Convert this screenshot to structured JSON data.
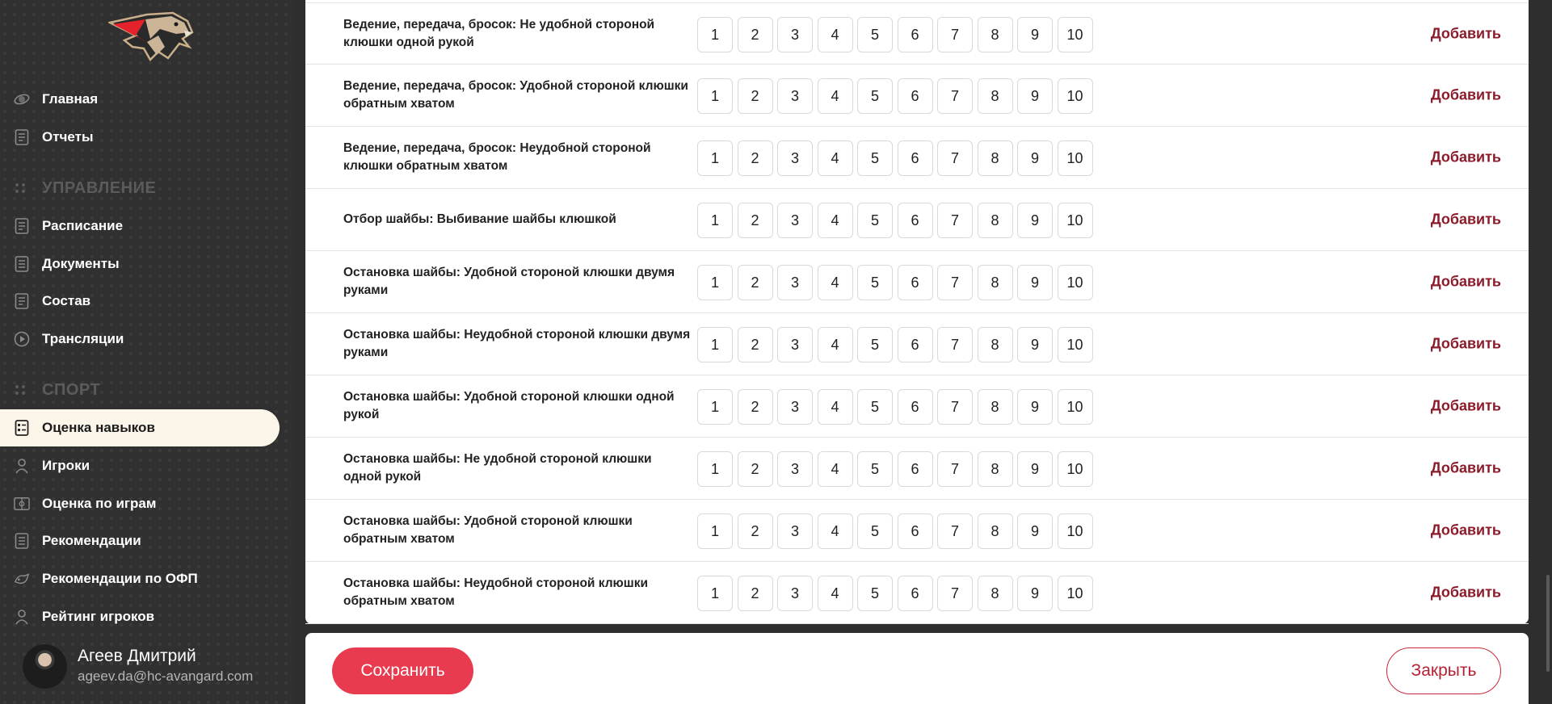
{
  "sidebar": {
    "items_main": [
      {
        "label": "Главная",
        "icon": "orbit-icon"
      },
      {
        "label": "Отчеты",
        "icon": "report-icon"
      }
    ],
    "section_manage": "УПРАВЛЕНИЕ",
    "items_manage": [
      {
        "label": "Расписание",
        "icon": "schedule-icon"
      },
      {
        "label": "Документы",
        "icon": "document-icon"
      },
      {
        "label": "Состав",
        "icon": "roster-icon"
      },
      {
        "label": "Трансляции",
        "icon": "play-circle-icon"
      }
    ],
    "section_sport": "СПОРТ",
    "items_sport": [
      {
        "label": "Оценка навыков",
        "icon": "skills-icon",
        "active": true
      },
      {
        "label": "Игроки",
        "icon": "player-icon"
      },
      {
        "label": "Оценка по играм",
        "icon": "game-rating-icon"
      },
      {
        "label": "Рекомендации",
        "icon": "recommendations-icon"
      },
      {
        "label": "Рекомендации по ОФП",
        "icon": "fitness-icon"
      },
      {
        "label": "Рейтинг игроков",
        "icon": "ranking-icon"
      }
    ]
  },
  "user": {
    "name": "Агеев Дмитрий",
    "email": "ageev.da@hc-avangard.com"
  },
  "scores": [
    "1",
    "2",
    "3",
    "4",
    "5",
    "6",
    "7",
    "8",
    "9",
    "10"
  ],
  "add_label": "Добавить",
  "skills": [
    "Ведение, передача, бросок: Не удобной стороной клюшки одной рукой",
    "Ведение, передача, бросок: Удобной стороной клюшки обратным хватом",
    "Ведение, передача, бросок: Неудобной стороной клюшки обратным хватом",
    "Отбор шайбы: Выбивание шайбы клюшкой",
    "Остановка шайбы: Удобной стороной клюшки двумя руками",
    "Остановка шайбы: Неудобной стороной клюшки двумя руками",
    "Остановка шайбы: Удобной стороной клюшки одной рукой",
    "Остановка шайбы: Не удобной стороной клюшки одной рукой",
    "Остановка шайбы: Удобной стороной клюшки обратным хватом",
    "Остановка шайбы: Неудобной стороной клюшки обратным хватом"
  ],
  "footer": {
    "save_label": "Сохранить",
    "close_label": "Закрыть"
  },
  "colors": {
    "accent": "#e83b4f",
    "link": "#8b1b2a",
    "sidebar_bg": "#303030",
    "active_bg": "#fbf5ea"
  }
}
